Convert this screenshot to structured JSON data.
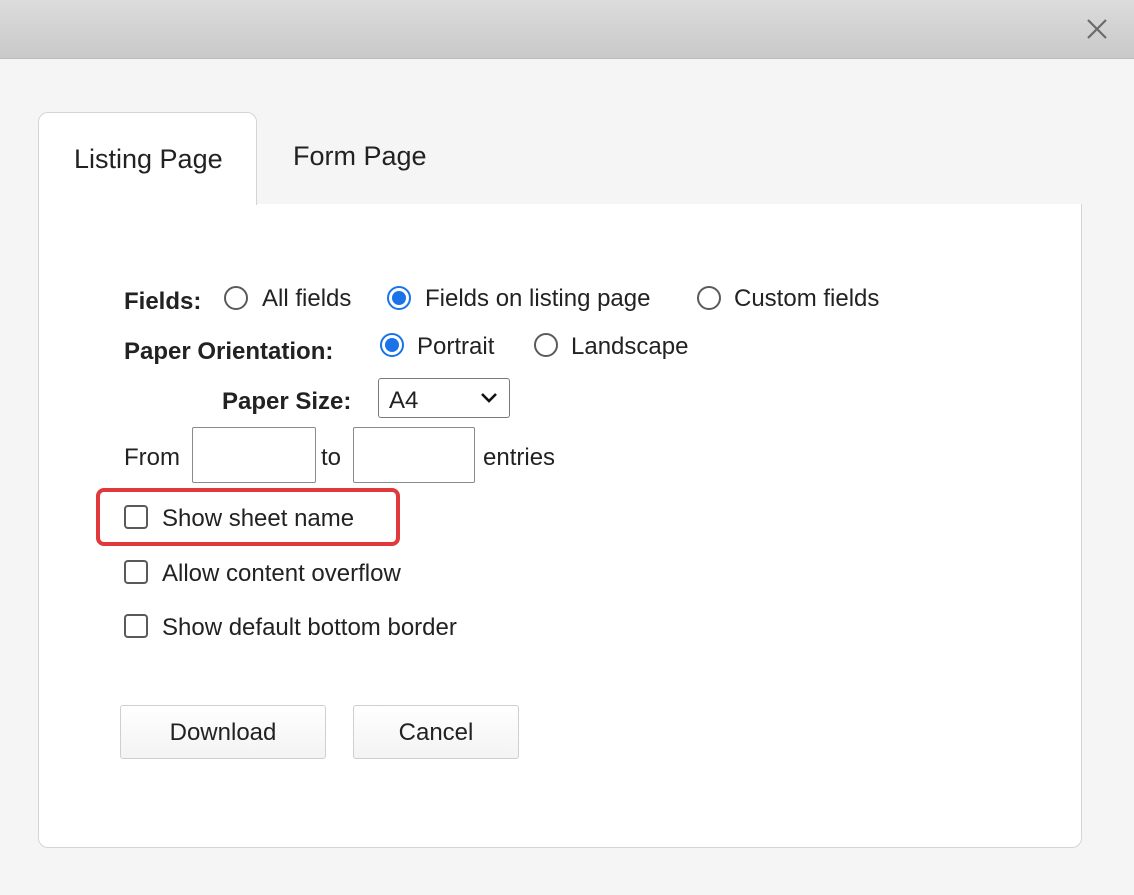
{
  "tabs": [
    {
      "label": "Listing Page",
      "active": true
    },
    {
      "label": "Form Page",
      "active": false
    }
  ],
  "fields": {
    "label": "Fields:",
    "options": [
      "All fields",
      "Fields on listing page",
      "Custom fields"
    ],
    "selected": "Fields on listing page"
  },
  "orientation": {
    "label": "Paper Orientation:",
    "options": [
      "Portrait",
      "Landscape"
    ],
    "selected": "Portrait"
  },
  "paper_size": {
    "label": "Paper Size:",
    "value": "A4"
  },
  "range": {
    "from_label": "From",
    "to_label": "to",
    "suffix": "entries",
    "from_value": "",
    "to_value": ""
  },
  "checkboxes": {
    "show_sheet_name": {
      "label": "Show sheet name",
      "checked": false
    },
    "allow_overflow": {
      "label": "Allow content overflow",
      "checked": false
    },
    "default_border": {
      "label": "Show default bottom border",
      "checked": false
    }
  },
  "buttons": {
    "download": "Download",
    "cancel": "Cancel"
  },
  "colors": {
    "accent": "#1a73e8",
    "highlight": "#e0383b"
  },
  "icons": {
    "close": "close-icon",
    "dropdown": "chevron-down-icon"
  }
}
